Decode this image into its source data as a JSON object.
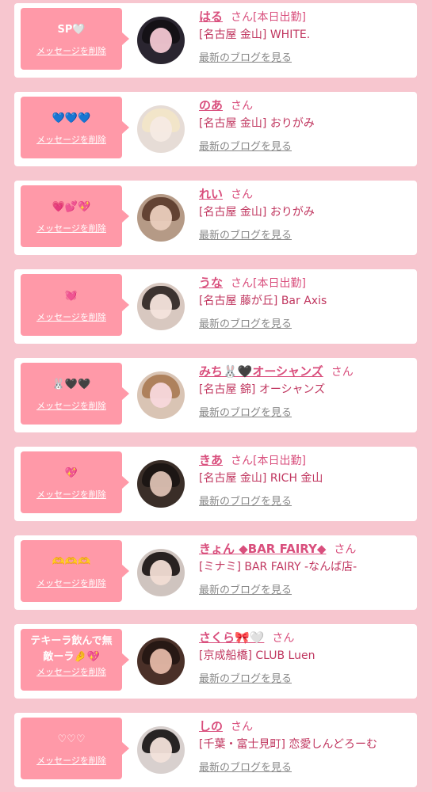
{
  "actions": {
    "delete_label": "メッセージを削除",
    "blog_label": "最新のブログを見る"
  },
  "colors": {
    "page_bg": "#f7c6cf",
    "bubble": "#ff99a8",
    "name": "#d94f7d",
    "shop": "#c0365f",
    "blog": "#888888"
  },
  "items": [
    {
      "message": "SP🤍",
      "name": "はる",
      "suffix": "さん[本日出勤]",
      "shop": "[名古屋 金山] WHITE."
    },
    {
      "message": "💙💙💙",
      "name": "のあ",
      "suffix": "さん",
      "shop": "[名古屋 金山] おりがみ"
    },
    {
      "message": "💗💕💖",
      "name": "れい",
      "suffix": "さん",
      "shop": "[名古屋 金山] おりがみ"
    },
    {
      "message": "💓",
      "name": "うな",
      "suffix": "さん[本日出勤]",
      "shop": "[名古屋 藤が丘] Bar Axis"
    },
    {
      "message": "🐰🖤🖤",
      "name": "みち🐰🖤オーシャンズ",
      "suffix": "さん",
      "shop": "[名古屋 錦] オーシャンズ"
    },
    {
      "message": "💖",
      "name": "きあ",
      "suffix": "さん[本日出勤]",
      "shop": "[名古屋 金山] RICH 金山"
    },
    {
      "message": "🫶🫶🫶",
      "name": "きょん ◆BAR FAIRY◆",
      "suffix": "さん",
      "shop": "[ミナミ] BAR FAIRY -なんば店-"
    },
    {
      "message": "テキーラ飲んで無敵ーラ🤌💖",
      "name": "さくら🎀🤍",
      "suffix": "さん",
      "shop": "[京成船橋] CLUB Luen"
    },
    {
      "message": "♡♡♡",
      "name": "しの",
      "suffix": "さん",
      "shop": "[千葉・富士見町] 恋愛しんどろーむ"
    }
  ]
}
